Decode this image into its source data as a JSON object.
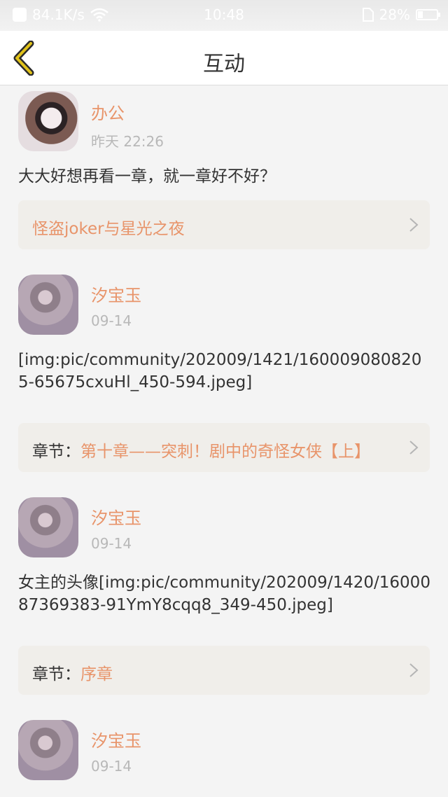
{
  "status_bar": {
    "speed": "84.1K/s",
    "time": "10:48",
    "battery": "28%",
    "battery_level": 0.28
  },
  "header": {
    "title": "互动",
    "back_icon": "chevron-left-icon"
  },
  "posts": [
    {
      "user": "办公",
      "time": "昨天 22:26",
      "content": "大大好想再看一章，就一章好不好？",
      "link_prefix": "",
      "link_text": "怪盗joker与星光之夜"
    },
    {
      "user": "汐宝玉",
      "time": "09-14",
      "content": "[img:pic/community/202009/1421/1600090808205-65675cxuHl_450-594.jpeg]",
      "link_prefix": "章节：",
      "link_text": "第十章——突刺！剧中的奇怪女侠【上】"
    },
    {
      "user": "汐宝玉",
      "time": "09-14",
      "content": "女主的头像[img:pic/community/202009/1420/1600087369383-91YmY8cqq8_349-450.jpeg]",
      "link_prefix": "章节：",
      "link_text": "序章"
    },
    {
      "user": "汐宝玉",
      "time": "09-14"
    }
  ],
  "colors": {
    "accent": "#e8946a",
    "link_bg": "#f0eeea",
    "back_arrow": "#e0c21a"
  }
}
